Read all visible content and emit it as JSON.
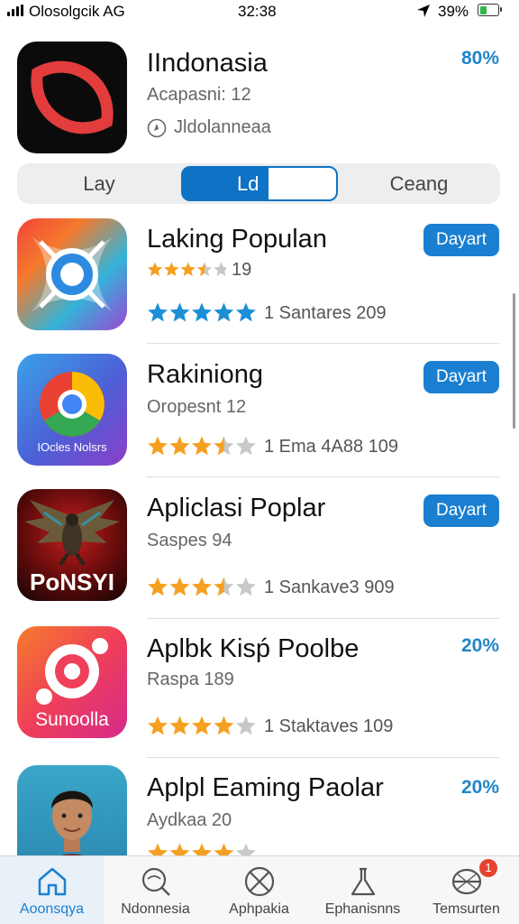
{
  "status_bar": {
    "carrier": "Olosolgcik AG",
    "time": "32:38",
    "battery_pct": "39%",
    "battery_level": 0.39,
    "battery_color": "#2fb84a"
  },
  "header_app": {
    "name": "IIndonasia",
    "subtitle": "Acapasni: 12",
    "meta": "Jldolanneaa",
    "percent": "80%",
    "icon": "eye-logo-icon"
  },
  "segments": {
    "items": [
      "Lay",
      "Ld",
      "Ceang"
    ],
    "selected_index": 1
  },
  "apps": [
    {
      "name": "Laking Populan",
      "rating_count": "19",
      "stars": 3.5,
      "star_color": "#f5a020",
      "second_rating": 5,
      "second_star_color": "#1c8fd6",
      "second_text": "1 Santares 209",
      "action": "Dayart",
      "icon": "target-cross-icon"
    },
    {
      "name": "Rakiniong",
      "subtitle": "Oropesnt 12",
      "stars": 3.5,
      "star_color": "#f5a020",
      "rating_text": "1 Ema 4A88 109",
      "action": "Dayart",
      "icon": "chrome-like-icon",
      "icon_caption": "IOcles Nolsrs"
    },
    {
      "name": "Apliclаsi Poplar",
      "subtitle": "Saspes 94",
      "stars": 3.5,
      "star_color": "#f5a020",
      "rating_text": "1 Sankave3 909",
      "action": "Dayart",
      "icon": "eagle-icon",
      "icon_caption": "PoNSYI"
    },
    {
      "name": "Aplbk Kisṕ Poolbe",
      "subtitle": "Raspa 189",
      "stars": 4,
      "star_color": "#f5a020",
      "rating_text": "1 Staktaves 109",
      "percent": "20%",
      "icon": "ring-logo-icon",
      "icon_caption": "Sunoolla"
    },
    {
      "name": "Aplpl Eaming Paolar",
      "subtitle": "Aydkaa 20",
      "stars": 4,
      "star_color": "#f5a020",
      "percent": "20%",
      "icon": "person-avatar-icon"
    }
  ],
  "tab_bar": {
    "items": [
      {
        "label": "Aoonsqya",
        "icon": "home-icon",
        "active": true
      },
      {
        "label": "Ndonnesia",
        "icon": "search-icon",
        "active": false
      },
      {
        "label": "Aphpakia",
        "icon": "crossed-circle-icon",
        "active": false
      },
      {
        "label": "Ephanisnns",
        "icon": "flask-icon",
        "active": false
      },
      {
        "label": "Temsurten",
        "icon": "inbox-icon",
        "active": false,
        "badge": "1"
      }
    ]
  },
  "colors": {
    "accent": "#1a7fd0",
    "percent_text": "#1f86c8",
    "star_orange": "#f5a020",
    "star_blue": "#1c8fd6",
    "star_empty": "#c8c8c8"
  }
}
